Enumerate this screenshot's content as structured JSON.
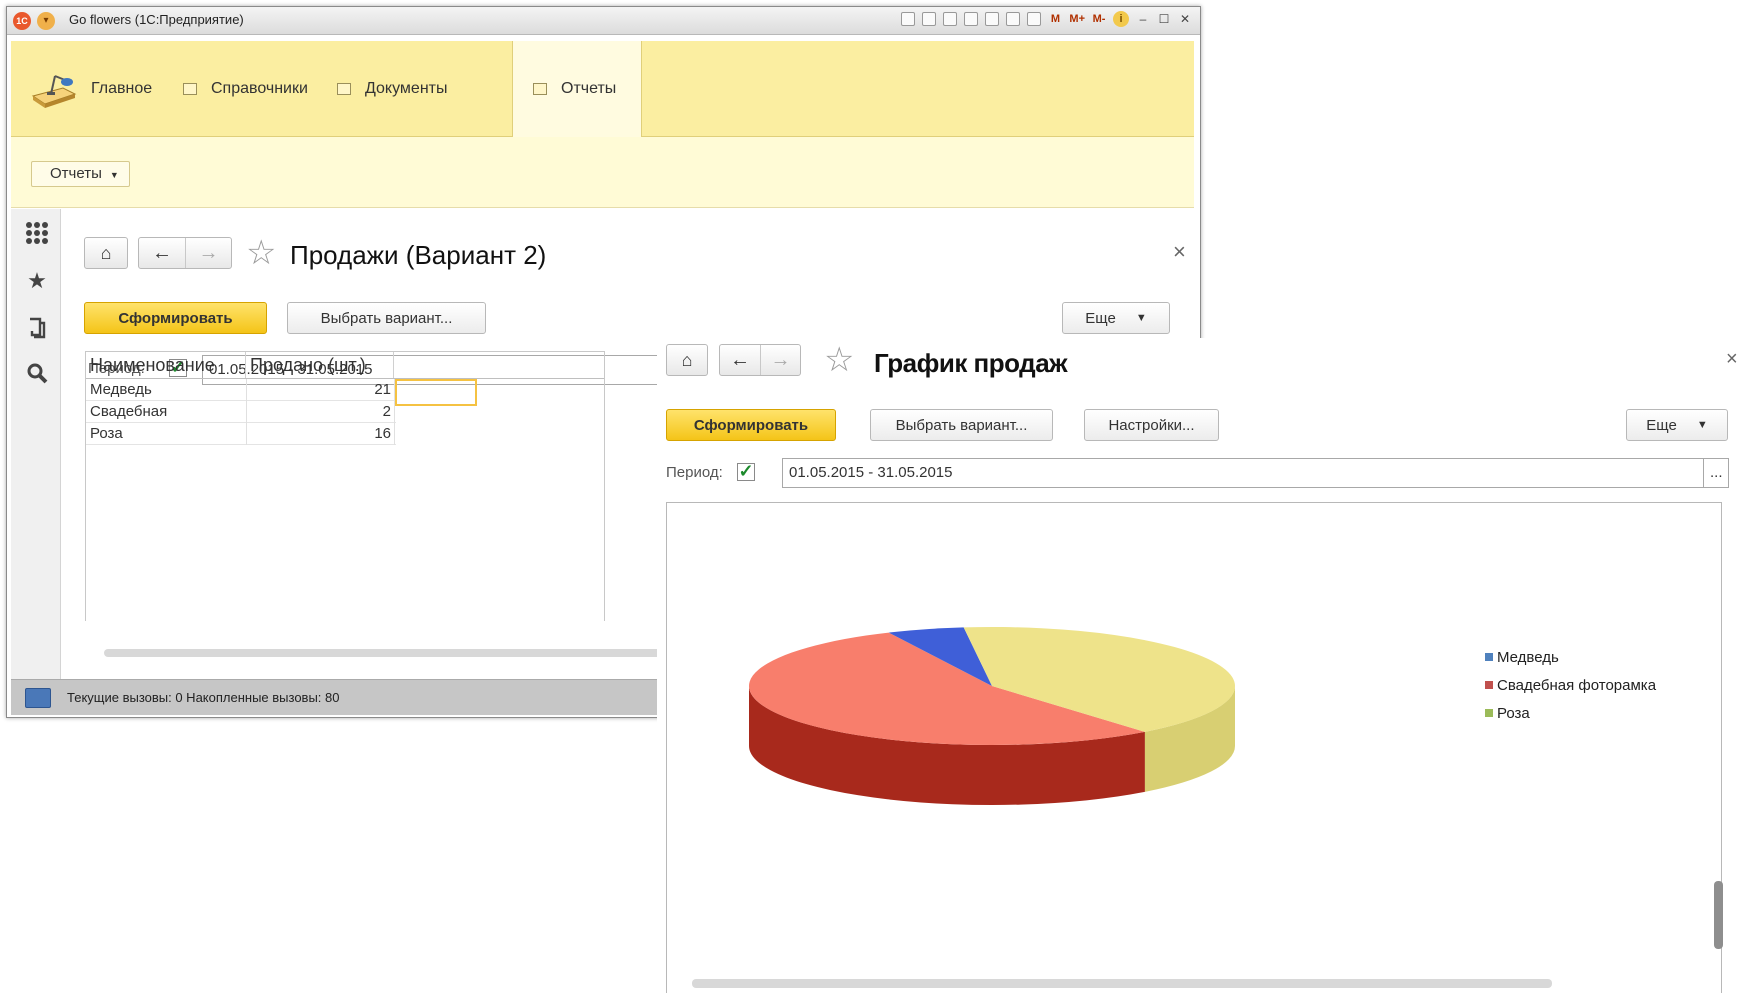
{
  "window": {
    "title": "Go flowers  (1С:Предприятие)",
    "logo_text": "1С",
    "toolbar_labels": [
      "M",
      "M+",
      "M-"
    ]
  },
  "sections": [
    {
      "label": "Главное"
    },
    {
      "label": "Справочники"
    },
    {
      "label": "Документы"
    },
    {
      "label": "Отчеты",
      "active": true
    }
  ],
  "subbar": {
    "reports_label": "Отчеты"
  },
  "report1": {
    "title": "Продажи (Вариант 2)",
    "generate_label": "Сформировать",
    "choose_variant_label": "Выбрать вариант...",
    "more_label": "Еще",
    "period_label": "Период:",
    "period_value": "01.05.2015 - 31.05.2015",
    "table": {
      "columns": [
        "Наименование",
        "Продано (шт.)"
      ],
      "rows": [
        {
          "name": "Медведь",
          "qty": "21"
        },
        {
          "name": "Свадебная",
          "qty": "2"
        },
        {
          "name": "Роза",
          "qty": "16"
        }
      ]
    }
  },
  "status": {
    "text": "Текущие вызовы: 0   Накопленные вызовы: 80"
  },
  "report2": {
    "title": "График продаж",
    "generate_label": "Сформировать",
    "choose_variant_label": "Выбрать вариант...",
    "settings_label": "Настройки...",
    "more_label": "Еще",
    "period_label": "Период:",
    "period_value": "01.05.2015 - 31.05.2015",
    "ellipsis": "..."
  },
  "chart_data": {
    "type": "pie",
    "title": "",
    "categories": [
      "Медведь",
      "Свадебная фоторамка",
      "Роза"
    ],
    "values": [
      21,
      2,
      16
    ],
    "colors": [
      "#f87e6c",
      "#3f5fd8",
      "#eee38a"
    ],
    "side_colors": [
      "#a8291c",
      "#050a88",
      "#d8cf72"
    ],
    "legend_colors": [
      "#4f81bd",
      "#c0504d",
      "#9bbb59"
    ],
    "legend": "right"
  }
}
